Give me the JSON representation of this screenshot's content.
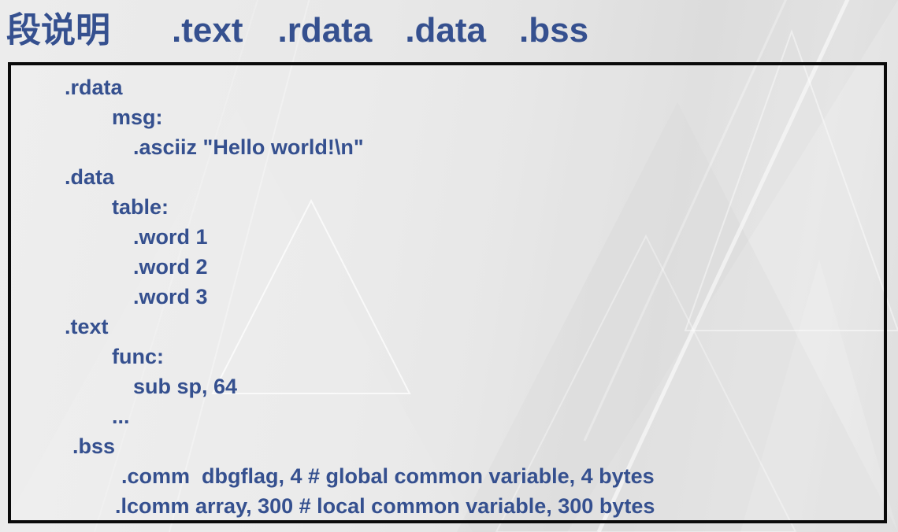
{
  "slide": {
    "title_cn": "段说明",
    "title_sections": [
      ".text",
      ".rdata",
      ".data",
      ".bss"
    ],
    "accent_color": "#35508f",
    "border_color": "#0a0a0a",
    "background_color": "#e9e9e9"
  },
  "code": {
    "lines": [
      {
        "indent": 68,
        "text": ".rdata"
      },
      {
        "indent": 128,
        "text": "msg:"
      },
      {
        "indent": 155,
        "text": ".asciiz \"Hello world!\\n\""
      },
      {
        "indent": 68,
        "text": ".data"
      },
      {
        "indent": 128,
        "text": "table:"
      },
      {
        "indent": 155,
        "text": ".word 1"
      },
      {
        "indent": 155,
        "text": ".word 2"
      },
      {
        "indent": 155,
        "text": ".word 3"
      },
      {
        "indent": 68,
        "text": ".text"
      },
      {
        "indent": 128,
        "text": "func:"
      },
      {
        "indent": 155,
        "text": "sub sp, 64"
      },
      {
        "indent": 128,
        "text": "..."
      },
      {
        "indent": 78,
        "text": ".bss"
      },
      {
        "indent": 140,
        "text": ".comm  dbgflag, 4 # global common variable, 4 bytes"
      },
      {
        "indent": 132,
        "text": ".lcomm array, 300 # local common variable, 300 bytes"
      }
    ]
  }
}
